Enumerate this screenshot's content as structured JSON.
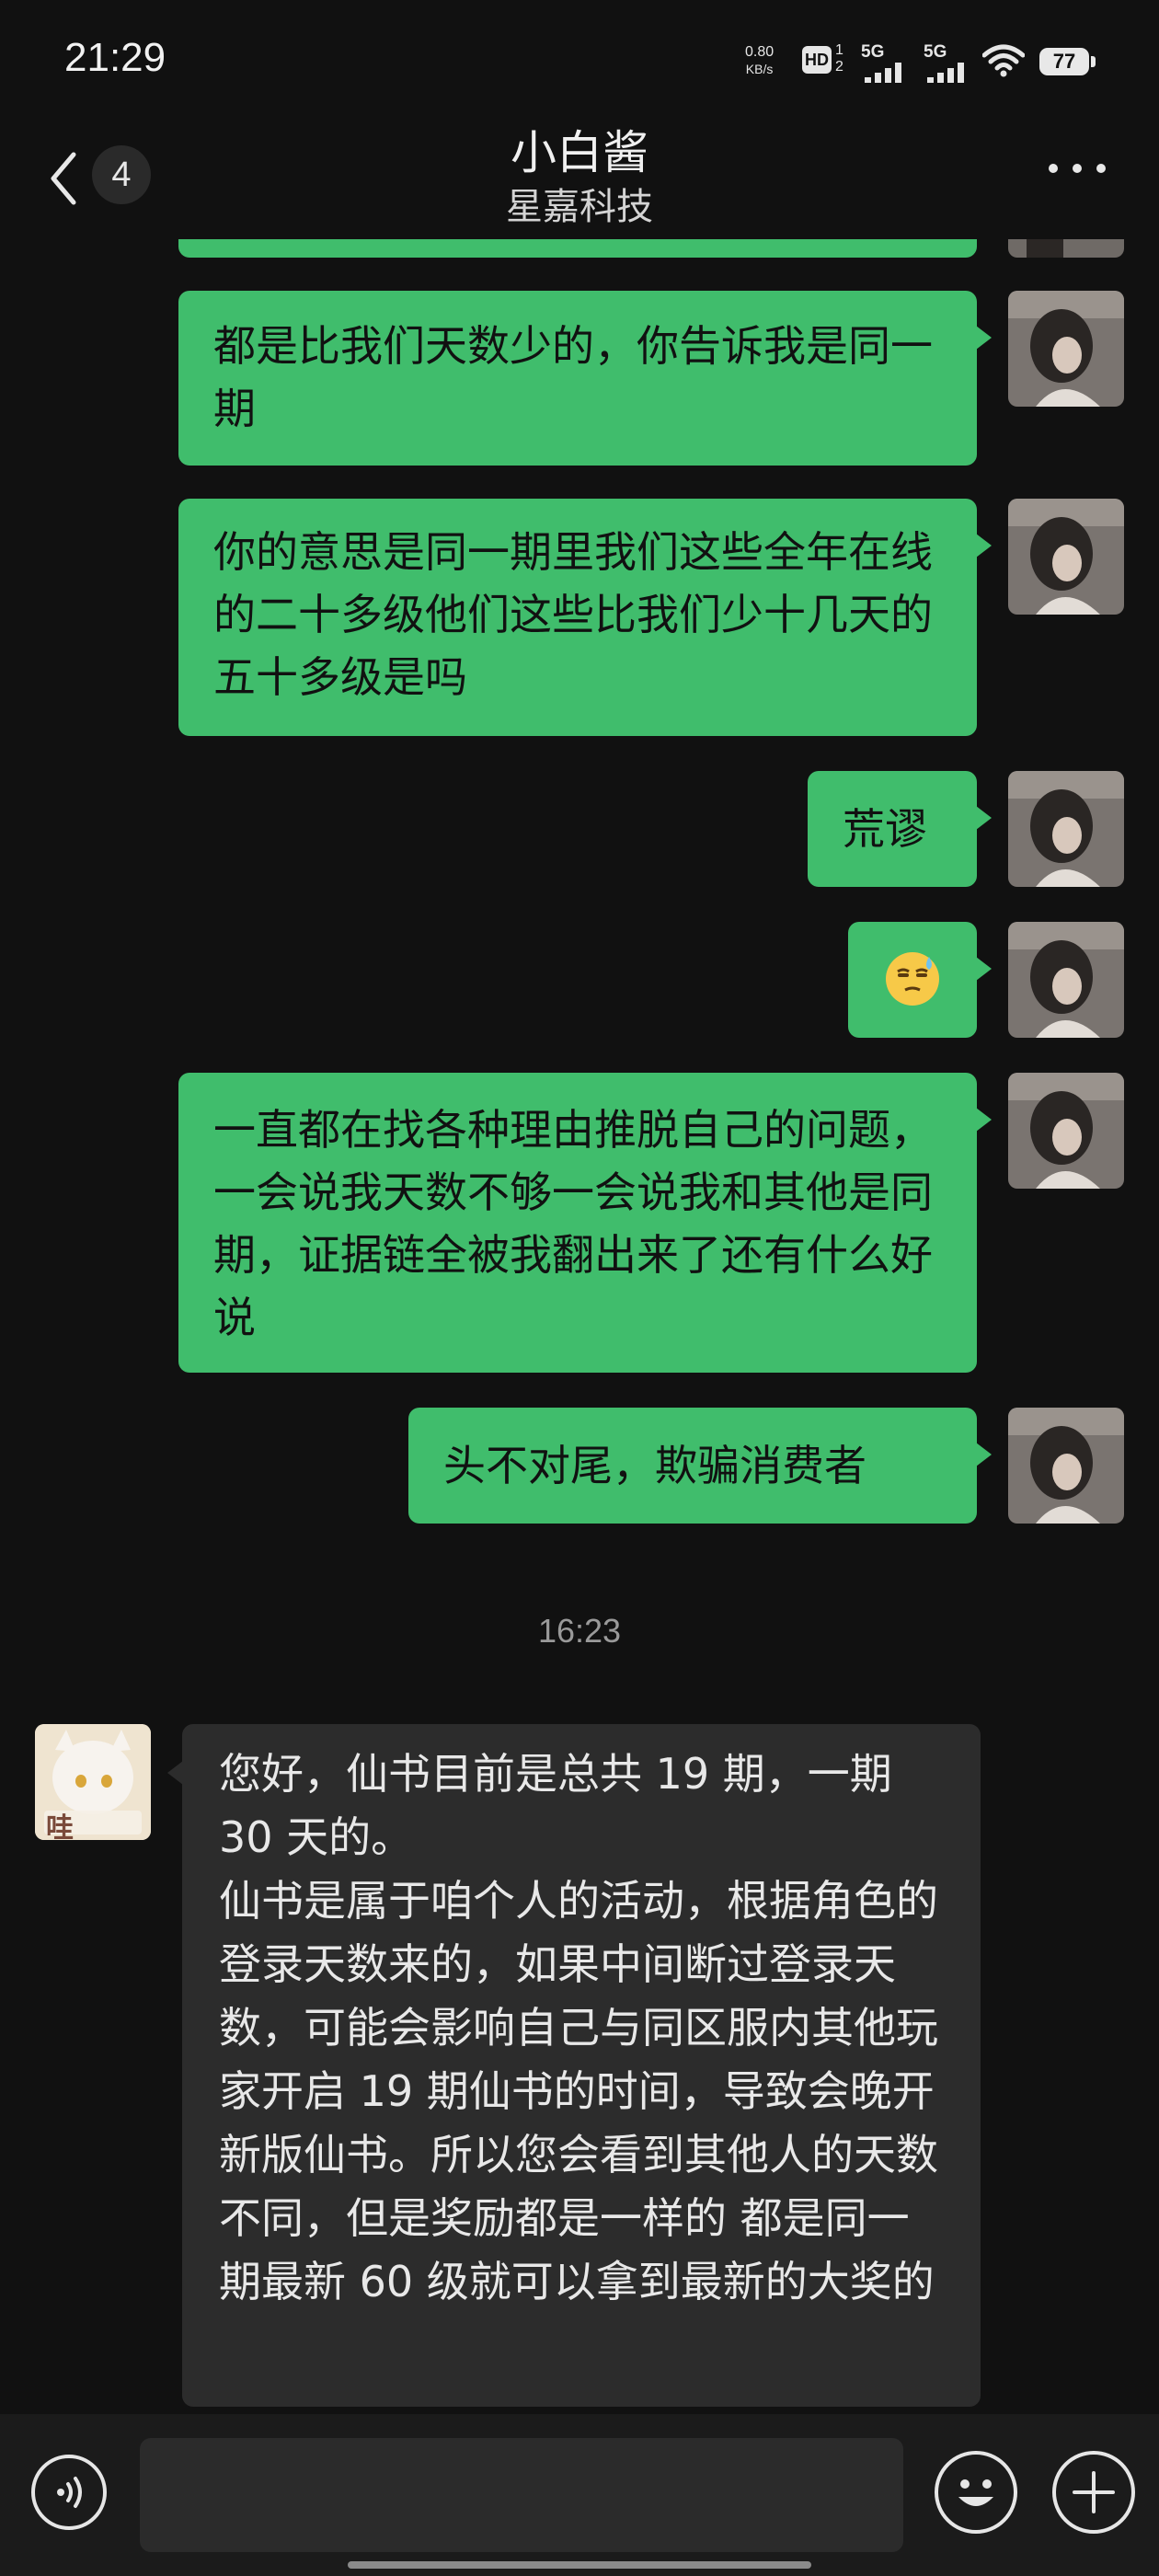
{
  "status_bar": {
    "time": "21:29",
    "net_speed_value": "0.80",
    "net_speed_unit": "KB/s",
    "hd_label": "HD",
    "hd_sup": "1",
    "hd_sub": "2",
    "sim1_label": "5G",
    "sim2_label": "5G",
    "battery": "77",
    "icons": [
      "network-speed",
      "hd-voice-icon",
      "signal-5g-icon",
      "signal-5g-icon",
      "wifi-icon",
      "battery-icon"
    ]
  },
  "nav": {
    "back_icon": "chevron-left-icon",
    "unread_count": "4",
    "title": "小白酱",
    "subtitle": "星嘉科技",
    "more_icon": "more-dots-icon"
  },
  "messages": [
    {
      "side": "right",
      "text": "都是比我们天数少的，你告诉我是同一期"
    },
    {
      "side": "right",
      "text": "你的意思是同一期里我们这些全年在线的二十多级他们这些比我们少十几天的五十多级是吗"
    },
    {
      "side": "right",
      "text": "荒谬"
    },
    {
      "side": "right",
      "type": "emoji",
      "emoji": "sweat-smile-emoji"
    },
    {
      "side": "right",
      "text": "一直都在找各种理由推脱自己的问题，一会说我天数不够一会说我和其他是同期，证据链全被我翻出来了还有什么好说"
    },
    {
      "side": "right",
      "text": "头不对尾，欺骗消费者"
    }
  ],
  "timestamp": "16:23",
  "reply": {
    "side": "left",
    "line1": "您好，仙书目前是总共 19 期，一期 30 天的。",
    "line2": "仙书是属于咱个人的活动，根据角色的登录天数来的，如果中间断过登录天数，可能会影响自己与同区服内其他玩家开启 19 期仙书的时间，导致会晚开新版仙书。所以您会看到其他人的天数不同，但是奖励都是一样的 都是同一期最新 60 级就可以拿到最新的大奖的",
    "avatar_text": "哇"
  },
  "input_bar": {
    "voice_icon": "voice-icon",
    "input_value": "",
    "emoji_icon": "smiley-icon",
    "plus_icon": "plus-icon"
  },
  "colors": {
    "background": "#111111",
    "bubble_self": "#40bd6c",
    "bubble_other": "#2c2c2c"
  }
}
